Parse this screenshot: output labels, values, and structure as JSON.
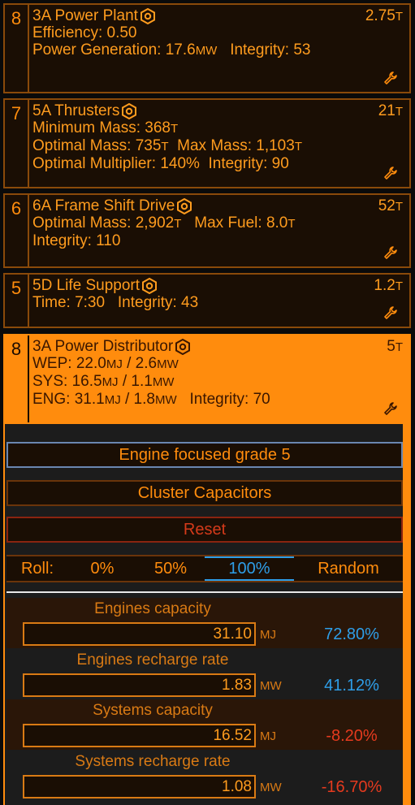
{
  "colors": {
    "accent": "#ff8c0d",
    "positive": "#2e9ee8",
    "negative": "#e53a1e",
    "background": "#0a0a0a"
  },
  "modules": [
    {
      "slot": "8",
      "name": "3A Power Plant",
      "mass_value": "2.75",
      "mass_unit": "T",
      "line1": "Efficiency: 0.50",
      "line2_a": "Power Generation: 17.6",
      "line2_unit": "MW",
      "line2_b": "Integrity: 53"
    },
    {
      "slot": "7",
      "name": "5A Thrusters",
      "mass_value": "21",
      "mass_unit": "T",
      "line1_a": "Minimum Mass: 368",
      "line1_unit": "T",
      "line2_a": "Optimal Mass: 735",
      "line2_unit": "T",
      "line2_b": "Max Mass: 1,103",
      "line2_unit2": "T",
      "line3": "Optimal Multiplier: 140%",
      "line3_b": "Integrity: 90"
    },
    {
      "slot": "6",
      "name": "6A Frame Shift Drive",
      "mass_value": "52",
      "mass_unit": "T",
      "line1_a": "Optimal Mass: 2,902",
      "line1_unit": "T",
      "line1_b": "Max Fuel: 8.0",
      "line1_unit2": "T",
      "line2": "Integrity: 110"
    },
    {
      "slot": "5",
      "name": "5D Life Support",
      "mass_value": "1.2",
      "mass_unit": "T",
      "line1": "Time: 7:30",
      "line1_b": "Integrity: 43"
    },
    {
      "slot": "8",
      "name": "3A Power Distributor",
      "mass_value": "5",
      "mass_unit": "T",
      "wep_a": "WEP: 22.0",
      "wep_u1": "MJ",
      "wep_b": " / 2.6",
      "wep_u2": "MW",
      "sys_a": "SYS: 16.5",
      "sys_u1": "MJ",
      "sys_b": " / 1.1",
      "sys_u2": "MW",
      "eng_a": "ENG: 31.1",
      "eng_u1": "MJ",
      "eng_b": " / 1.8",
      "eng_u2": "MW",
      "eng_c": "Integrity: 70"
    }
  ],
  "engineering": {
    "blueprint": "Engine focused grade 5",
    "experimental": "Cluster Capacitors",
    "reset": "Reset",
    "roll": {
      "label": "Roll:",
      "options": [
        "0%",
        "50%",
        "100%"
      ],
      "random": "Random",
      "selected": "100%"
    },
    "stats": [
      {
        "label": "Engines capacity",
        "value": "31.10",
        "unit": "MJ",
        "change": "72.80%",
        "positive": true
      },
      {
        "label": "Engines recharge rate",
        "value": "1.83",
        "unit": "MW",
        "change": "41.12%",
        "positive": true
      },
      {
        "label": "Systems capacity",
        "value": "16.52",
        "unit": "MJ",
        "change": "-8.20%",
        "positive": false
      },
      {
        "label": "Systems recharge rate",
        "value": "1.08",
        "unit": "MW",
        "change": "-16.70%",
        "positive": false
      }
    ]
  }
}
